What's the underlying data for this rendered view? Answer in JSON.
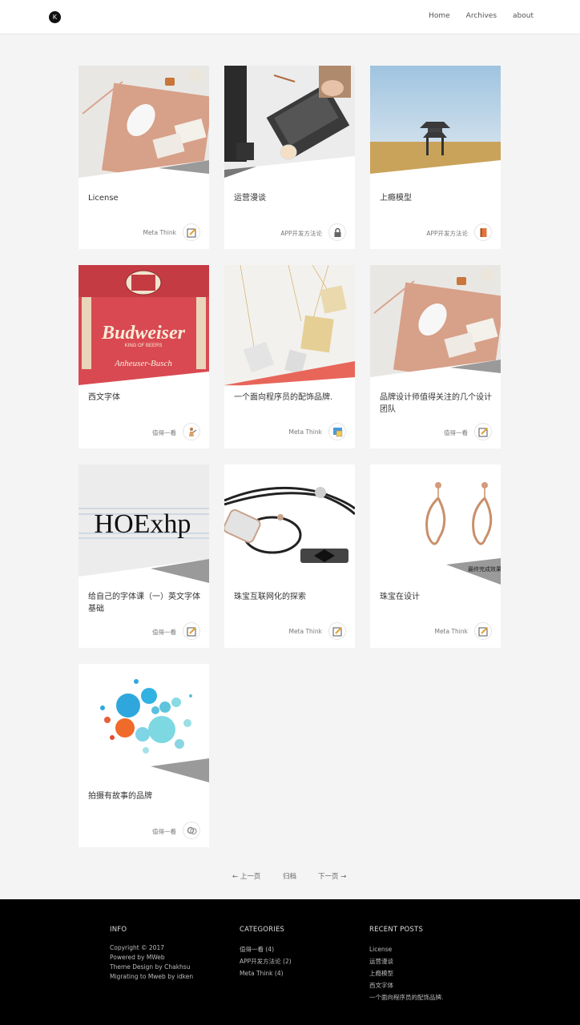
{
  "header": {
    "logo_letter": "K",
    "nav": [
      "Home",
      "Archives",
      "about"
    ]
  },
  "posts": [
    {
      "title": "License",
      "category": "Meta Think",
      "icon": "pencil-icon"
    },
    {
      "title": "运营漫谈",
      "category": "APP开发方法论",
      "icon": "lock-icon"
    },
    {
      "title": "上瘾模型",
      "category": "APP开发方法论",
      "icon": "book-icon"
    },
    {
      "title": "西文字体",
      "category": "值得一看",
      "icon": "person-icon",
      "thumb_text": {
        "brand": "Budweiser",
        "sub": "KING OF BEERS",
        "maker": "Anheuser-Busch"
      }
    },
    {
      "title": "一个面向程序员的配饰品牌.",
      "category": "Meta Think",
      "icon": "picture-icon"
    },
    {
      "title": "品牌设计师值得关注的几个设计团队",
      "category": "值得一看",
      "icon": "pencil-icon"
    },
    {
      "title": "给自己的字体课（一）英文字体基础",
      "category": "值得一看",
      "icon": "pencil-icon",
      "thumb_text": {
        "word": "HOExhp"
      }
    },
    {
      "title": "珠宝互联网化的探索",
      "category": "Meta Think",
      "icon": "pencil-icon"
    },
    {
      "title": "珠宝在设计",
      "category": "Meta Think",
      "icon": "pencil-icon",
      "thumb_text": {
        "caption": "最终完成效果"
      }
    },
    {
      "title": "拍摄有故事的品牌",
      "category": "值得一看",
      "icon": "rings-icon"
    }
  ],
  "pager": {
    "prev": "← 上一页",
    "archive": "归档",
    "next": "下一页 →"
  },
  "footer": {
    "info_heading": "INFO",
    "info_lines": [
      "Copyright © 2017",
      "Powered by MWeb",
      "Theme Design by Chakhsu",
      "Migrating to Mweb by idken"
    ],
    "categories_heading": "CATEGORIES",
    "categories": [
      "值得一看 (4)",
      "APP开发方法论 (2)",
      "Meta Think (4)"
    ],
    "recent_heading": "RECENT POSTS",
    "recent": [
      "License",
      "运营漫谈",
      "上瘾模型",
      "西文字体",
      "一个面向程序员的配饰品牌."
    ]
  }
}
